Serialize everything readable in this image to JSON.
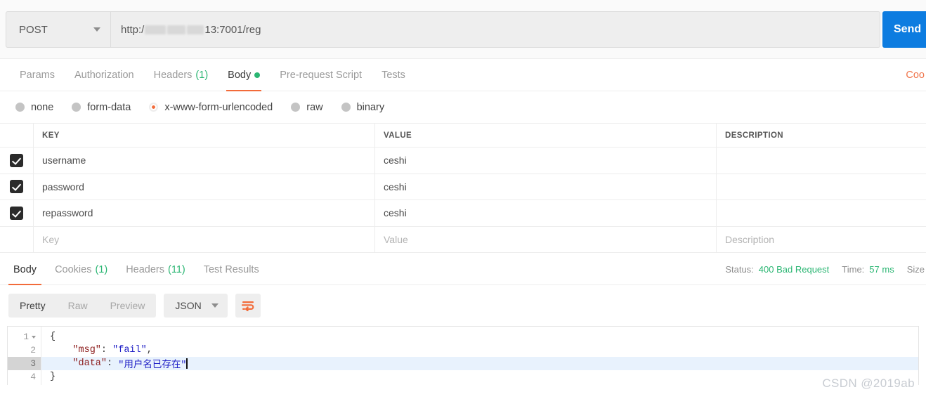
{
  "request": {
    "method": "POST",
    "method_caret_icon": "chevron-down-icon",
    "url_prefix": "http:/",
    "url_suffix": "13:7001/reg",
    "url_redacted": true,
    "send_label": "Send",
    "send_color": "#0d7ce0"
  },
  "request_tabs": {
    "items": [
      {
        "label": "Params",
        "count": "",
        "active": false,
        "dot": false
      },
      {
        "label": "Authorization",
        "count": "",
        "active": false,
        "dot": false
      },
      {
        "label": "Headers",
        "count": "(1)",
        "active": false,
        "dot": false
      },
      {
        "label": "Body",
        "count": "",
        "active": true,
        "dot": true
      },
      {
        "label": "Pre-request Script",
        "count": "",
        "active": false,
        "dot": false
      },
      {
        "label": "Tests",
        "count": "",
        "active": false,
        "dot": false
      }
    ],
    "cookies_link": "Coo",
    "accent_color": "#f26b3a",
    "dot_color": "#2bb673"
  },
  "body_type": {
    "options": [
      {
        "label": "none",
        "selected": false
      },
      {
        "label": "form-data",
        "selected": false
      },
      {
        "label": "x-www-form-urlencoded",
        "selected": true
      },
      {
        "label": "raw",
        "selected": false
      },
      {
        "label": "binary",
        "selected": false
      }
    ],
    "selected_color": "#f26b3a"
  },
  "params_table": {
    "columns": [
      "KEY",
      "VALUE",
      "DESCRIPTION"
    ],
    "rows": [
      {
        "checked": true,
        "key": "username",
        "value": "ceshi",
        "description": ""
      },
      {
        "checked": true,
        "key": "password",
        "value": "ceshi",
        "description": ""
      },
      {
        "checked": true,
        "key": "repassword",
        "value": "ceshi",
        "description": ""
      }
    ],
    "placeholder_row": {
      "key": "Key",
      "value": "Value",
      "description": "Description"
    }
  },
  "response_tabs": {
    "items": [
      {
        "label": "Body",
        "count": "",
        "active": true
      },
      {
        "label": "Cookies",
        "count": "(1)",
        "active": false
      },
      {
        "label": "Headers",
        "count": "(11)",
        "active": false
      },
      {
        "label": "Test Results",
        "count": "",
        "active": false
      }
    ],
    "status_label": "Status:",
    "status_value": "400 Bad Request",
    "time_label": "Time:",
    "time_value": "57 ms",
    "size_label": "Size",
    "status_color": "#2bb673"
  },
  "format_bar": {
    "view_modes": [
      {
        "label": "Pretty",
        "active": true
      },
      {
        "label": "Raw",
        "active": false
      },
      {
        "label": "Preview",
        "active": false
      }
    ],
    "format": "JSON",
    "format_caret_icon": "chevron-down-icon",
    "wrap_icon": "word-wrap-icon",
    "wrap_icon_color": "#f26b3a"
  },
  "code_viewer": {
    "lines": [
      {
        "num": "1",
        "foldable": true,
        "highlighted": false,
        "indent": 0,
        "tokens": [
          {
            "t": "punct",
            "v": "{"
          }
        ]
      },
      {
        "num": "2",
        "foldable": false,
        "highlighted": false,
        "indent": 1,
        "tokens": [
          {
            "t": "key",
            "v": "\"msg\""
          },
          {
            "t": "punct",
            "v": ": "
          },
          {
            "t": "str",
            "v": "\"fail\""
          },
          {
            "t": "punct",
            "v": ","
          }
        ]
      },
      {
        "num": "3",
        "foldable": false,
        "highlighted": true,
        "indent": 1,
        "cursor": true,
        "tokens": [
          {
            "t": "key",
            "v": "\"data\""
          },
          {
            "t": "punct",
            "v": ": "
          },
          {
            "t": "str",
            "v": "\"用户名已存在\""
          }
        ]
      },
      {
        "num": "4",
        "foldable": false,
        "highlighted": false,
        "indent": 0,
        "tokens": [
          {
            "t": "punct",
            "v": "}"
          }
        ]
      }
    ]
  },
  "watermark": "CSDN @2019ab"
}
